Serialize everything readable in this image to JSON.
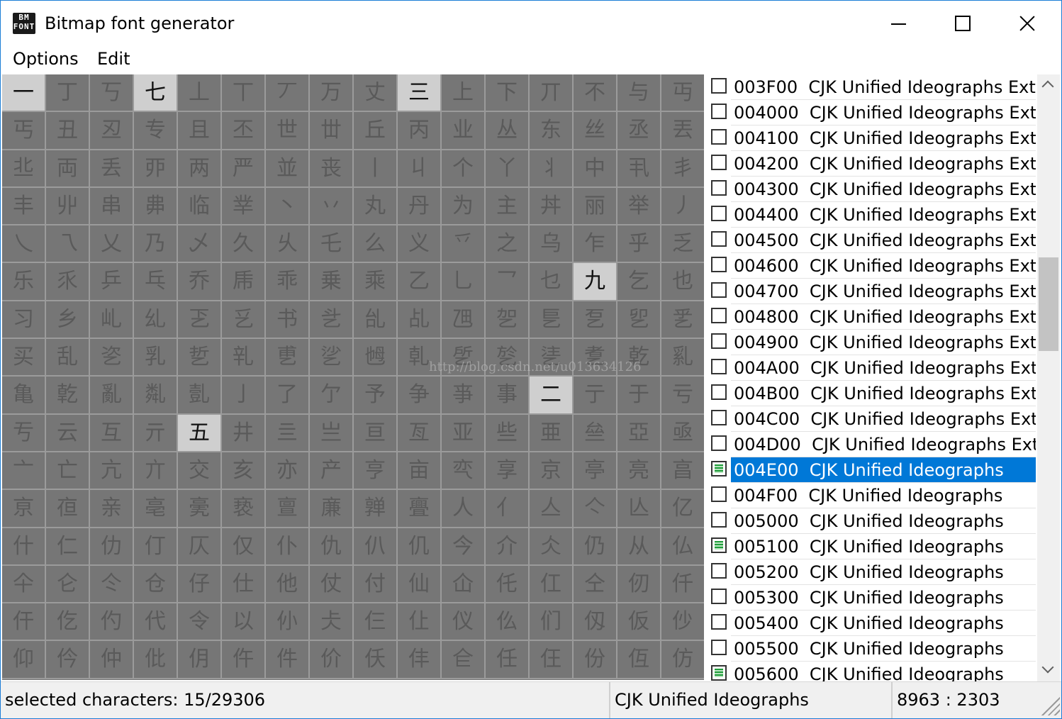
{
  "window": {
    "title": "Bitmap font generator",
    "icon_text": [
      "BM",
      "FONT"
    ]
  },
  "menu": {
    "options": "Options",
    "edit": "Edit"
  },
  "grid": {
    "cells": [
      "一",
      "丁",
      "丂",
      "七",
      "丄",
      "丅",
      "丆",
      "万",
      "丈",
      "三",
      "上",
      "下",
      "丌",
      "不",
      "与",
      "丏",
      "丐",
      "丑",
      "丒",
      "专",
      "且",
      "丕",
      "世",
      "丗",
      "丘",
      "丙",
      "业",
      "丛",
      "东",
      "丝",
      "丞",
      "丟",
      "丠",
      "両",
      "丢",
      "丣",
      "两",
      "严",
      "並",
      "丧",
      "丨",
      "丩",
      "个",
      "丫",
      "丬",
      "中",
      "丮",
      "丯",
      "丰",
      "丱",
      "串",
      "丳",
      "临",
      "丵",
      "丶",
      "丷",
      "丸",
      "丹",
      "为",
      "主",
      "丼",
      "丽",
      "举",
      "丿",
      "乀",
      "乁",
      "乂",
      "乃",
      "乄",
      "久",
      "乆",
      "乇",
      "么",
      "义",
      "乊",
      "之",
      "乌",
      "乍",
      "乎",
      "乏",
      "乐",
      "乑",
      "乒",
      "乓",
      "乔",
      "乕",
      "乖",
      "乗",
      "乘",
      "乙",
      "乚",
      "乛",
      "乜",
      "九",
      "乞",
      "也",
      "习",
      "乡",
      "乢",
      "乣",
      "乤",
      "乥",
      "书",
      "乧",
      "乨",
      "乩",
      "乪",
      "乫",
      "乬",
      "乭",
      "乮",
      "乯",
      "买",
      "乱",
      "乲",
      "乳",
      "乴",
      "乵",
      "乶",
      "乷",
      "乸",
      "乹",
      "乺",
      "乻",
      "乼",
      "乽",
      "乾",
      "乿",
      "亀",
      "亁",
      "亂",
      "亃",
      "亄",
      "亅",
      "了",
      "亇",
      "予",
      "争",
      "亊",
      "事",
      "二",
      "亍",
      "于",
      "亏",
      "亐",
      "云",
      "互",
      "亓",
      "五",
      "井",
      "亖",
      "亗",
      "亘",
      "亙",
      "亚",
      "些",
      "亜",
      "亝",
      "亞",
      "亟",
      "亠",
      "亡",
      "亢",
      "亣",
      "交",
      "亥",
      "亦",
      "产",
      "亨",
      "亩",
      "亪",
      "享",
      "京",
      "亭",
      "亮",
      "亯",
      "亰",
      "亱",
      "亲",
      "亳",
      "亴",
      "亵",
      "亶",
      "亷",
      "亸",
      "亹",
      "人",
      "亻",
      "亼",
      "亽",
      "亾",
      "亿",
      "什",
      "仁",
      "仂",
      "仃",
      "仄",
      "仅",
      "仆",
      "仇",
      "仈",
      "仉",
      "今",
      "介",
      "仌",
      "仍",
      "从",
      "仏",
      "仐",
      "仑",
      "仒",
      "仓",
      "仔",
      "仕",
      "他",
      "仗",
      "付",
      "仙",
      "仚",
      "仛",
      "仜",
      "仝",
      "仞",
      "仟",
      "仠",
      "仡",
      "仢",
      "代",
      "令",
      "以",
      "仦",
      "仧",
      "仨",
      "仩",
      "仪",
      "仫",
      "们",
      "仭",
      "仮",
      "仯",
      "仰",
      "仱",
      "仲",
      "仳",
      "仴",
      "仵",
      "件",
      "价",
      "仸",
      "仹",
      "仺",
      "任",
      "仼",
      "份",
      "仾",
      "仿"
    ],
    "selected_indices": [
      0,
      3,
      9,
      93,
      140,
      148
    ]
  },
  "ranges": [
    {
      "code": "003F00",
      "name": "CJK Unified Ideographs Exte",
      "state": "none"
    },
    {
      "code": "004000",
      "name": "CJK Unified Ideographs Exte",
      "state": "none"
    },
    {
      "code": "004100",
      "name": "CJK Unified Ideographs Exte",
      "state": "none"
    },
    {
      "code": "004200",
      "name": "CJK Unified Ideographs Exte",
      "state": "none"
    },
    {
      "code": "004300",
      "name": "CJK Unified Ideographs Exte",
      "state": "none"
    },
    {
      "code": "004400",
      "name": "CJK Unified Ideographs Exte",
      "state": "none"
    },
    {
      "code": "004500",
      "name": "CJK Unified Ideographs Exte",
      "state": "none"
    },
    {
      "code": "004600",
      "name": "CJK Unified Ideographs Exte",
      "state": "none"
    },
    {
      "code": "004700",
      "name": "CJK Unified Ideographs Exte",
      "state": "none"
    },
    {
      "code": "004800",
      "name": "CJK Unified Ideographs Exte",
      "state": "none"
    },
    {
      "code": "004900",
      "name": "CJK Unified Ideographs Exte",
      "state": "none"
    },
    {
      "code": "004A00",
      "name": "CJK Unified Ideographs Exte",
      "state": "none"
    },
    {
      "code": "004B00",
      "name": "CJK Unified Ideographs Exte",
      "state": "none"
    },
    {
      "code": "004C00",
      "name": "CJK Unified Ideographs Exte",
      "state": "none"
    },
    {
      "code": "004D00",
      "name": "CJK Unified Ideographs Exte",
      "state": "none"
    },
    {
      "code": "004E00",
      "name": "CJK Unified Ideographs",
      "state": "partial",
      "active": true
    },
    {
      "code": "004F00",
      "name": "CJK Unified Ideographs",
      "state": "none"
    },
    {
      "code": "005000",
      "name": "CJK Unified Ideographs",
      "state": "none"
    },
    {
      "code": "005100",
      "name": "CJK Unified Ideographs",
      "state": "partial"
    },
    {
      "code": "005200",
      "name": "CJK Unified Ideographs",
      "state": "none"
    },
    {
      "code": "005300",
      "name": "CJK Unified Ideographs",
      "state": "none"
    },
    {
      "code": "005400",
      "name": "CJK Unified Ideographs",
      "state": "none"
    },
    {
      "code": "005500",
      "name": "CJK Unified Ideographs",
      "state": "none"
    },
    {
      "code": "005600",
      "name": "CJK Unified Ideographs",
      "state": "partial"
    }
  ],
  "status": {
    "selected": "selected characters: 15/29306",
    "block": "CJK Unified Ideographs",
    "coords": "8963 : 2303"
  },
  "watermark": "http://blog.csdn.net/u013634126",
  "colors": {
    "grid_bg": "#767676",
    "selected_cell": "#cfcfcf",
    "active_row": "#0078d7",
    "partial_check": "#1f9d3a"
  }
}
